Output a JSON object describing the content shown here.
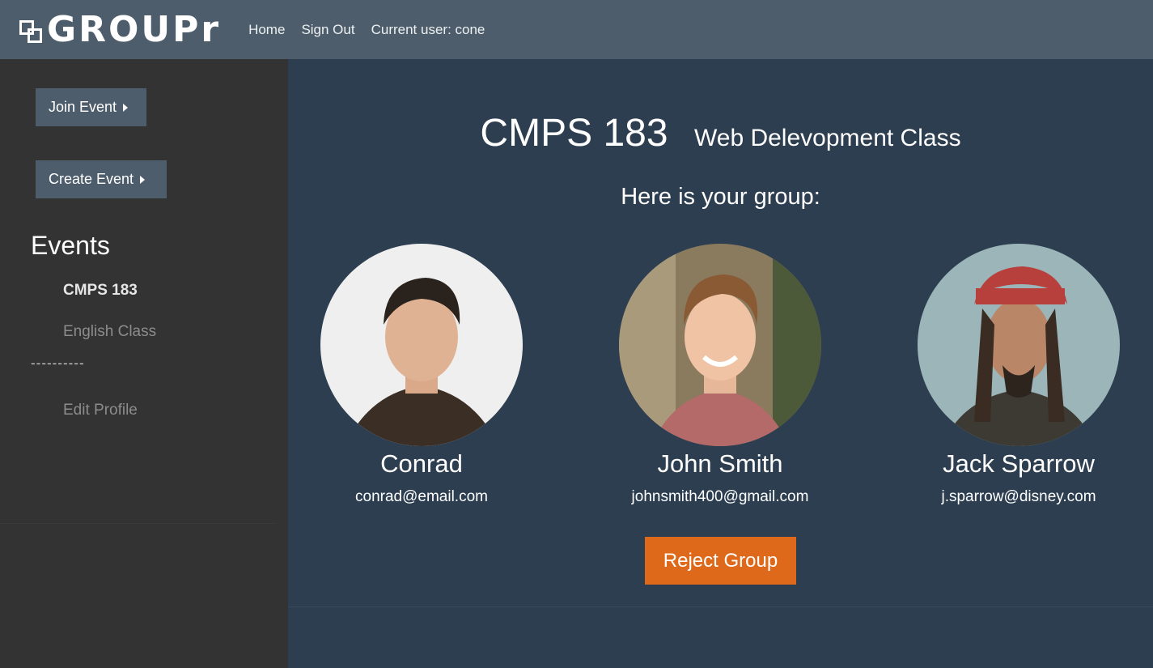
{
  "navbar": {
    "brand": "GROUPr",
    "links": [
      "Home",
      "Sign Out",
      "Current user: cone"
    ]
  },
  "sidebar": {
    "join_label": "Join Event",
    "create_label": "Create Event",
    "events_heading": "Events",
    "events": [
      "CMPS 183",
      "English Class"
    ],
    "divider": "----------",
    "edit_profile": "Edit Profile"
  },
  "main": {
    "class_code": "CMPS 183",
    "class_name": "Web Delevopment Class",
    "group_heading": "Here is your group:",
    "members": [
      {
        "name": "Conrad",
        "email": "conrad@email.com"
      },
      {
        "name": "John Smith",
        "email": "johnsmith400@gmail.com"
      },
      {
        "name": "Jack Sparrow",
        "email": "j.sparrow@disney.com"
      }
    ],
    "reject_label": "Reject Group"
  },
  "colors": {
    "navbar": "#4e5d6c",
    "sidebar": "#333333",
    "main_bg": "#2c3e50",
    "accent": "#df691a"
  }
}
